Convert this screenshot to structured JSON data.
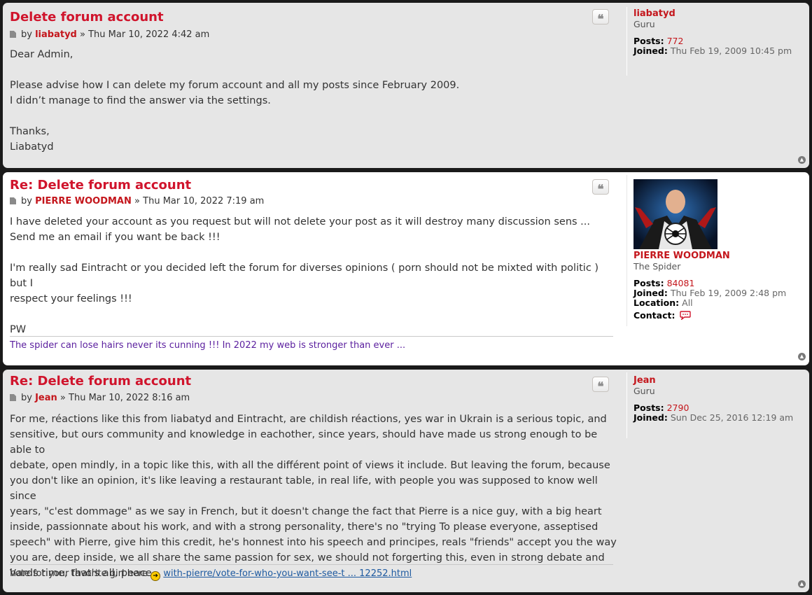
{
  "posts": [
    {
      "title": "Delete forum account",
      "by": "by",
      "author": "liabatyd",
      "sep": "»",
      "date": "Thu Mar 10, 2022 4:42 am",
      "lines": [
        "Dear Admin,",
        "",
        "Please advise how I can delete my forum account and all my posts since February 2009.",
        "I didn’t manage to find the answer via the settings.",
        "",
        "Thanks,",
        "Liabatyd"
      ],
      "profile": {
        "username": "liabatyd",
        "rank": "Guru",
        "posts_label": "Posts:",
        "posts": "772",
        "joined_label": "Joined:",
        "joined": "Thu Feb 19, 2009 10:45 pm"
      }
    },
    {
      "title": "Re: Delete forum account",
      "by": "by",
      "author": "PIERRE WOODMAN",
      "sep": "»",
      "date": "Thu Mar 10, 2022 7:19 am",
      "lines": [
        "I have deleted your account as you request but will not delete your post as it will destroy many discussion sens ...",
        "Send me an email if you want be back !!!",
        "",
        "I'm really sad Eintracht or you decided left the forum for diverses opinions ( porn should not be mixted with politic ) but I",
        "respect your feelings !!!",
        "",
        "PW"
      ],
      "signature": "The spider can lose hairs never its cunning !!! In 2022 my web is stronger than ever ...",
      "profile": {
        "username": "PIERRE WOODMAN",
        "rank": "The Spider",
        "posts_label": "Posts:",
        "posts": "84081",
        "joined_label": "Joined:",
        "joined": "Thu Feb 19, 2009 2:48 pm",
        "location_label": "Location:",
        "location": "All",
        "contact_label": "Contact:"
      }
    },
    {
      "title": "Re: Delete forum account",
      "by": "by",
      "author": "Jean",
      "sep": "»",
      "date": "Thu Mar 10, 2022 8:16 am",
      "lines": [
        "For me, réactions like this from liabatyd and Eintracht, are childish réactions, yes war in Ukrain is a serious topic, and",
        "sensitive, but ours community and knowledge in eachother, since years, should have made us strong enough to be able to",
        "debate, open mindly, in a topic like this, with all the différent point of views it include. But leaving the forum, because",
        "you don't like an opinion, it's like leaving a restaurant table, in real life, with people you was supposed to know well since",
        "years, \"c'est dommage\" as we say in French, but it doesn't change the fact that Pierre is a nice guy, with a big heart",
        "inside, passionnate about his work, and with a strong personality, there's no \"trying To please everyone, asseptised",
        "speech\" with Pierre, give him this credit, he's honnest into his speech and principes, reals \"friends\" accept you the way",
        "you are, deep inside, we all share the same passion for sex, we should not forgerting this, even in strong debate and",
        "hards time, that's all, peace"
      ],
      "signature_text": "Vote for your favorite girl here",
      "signature_link": "with-pierre/vote-for-who-you-want-see-t ... 12252.html",
      "profile": {
        "username": "Jean",
        "rank": "Guru",
        "posts_label": "Posts:",
        "posts": "2790",
        "joined_label": "Joined:",
        "joined": "Sun Dec 25, 2016 12:19 am"
      }
    }
  ],
  "quote_glyph": "❝",
  "icons": {
    "post": "post-icon",
    "quote": "quote-icon",
    "top": "back-to-top-icon",
    "contact": "speech-bubble-icon",
    "arrow": "arrow-right-icon"
  },
  "colors": {
    "title": "#d0142c",
    "username": "#c4161c",
    "signature": "#5a1e9e",
    "link": "#1e5aa0",
    "bg1": "#e6e6e6",
    "bg2": "#ffffff"
  }
}
